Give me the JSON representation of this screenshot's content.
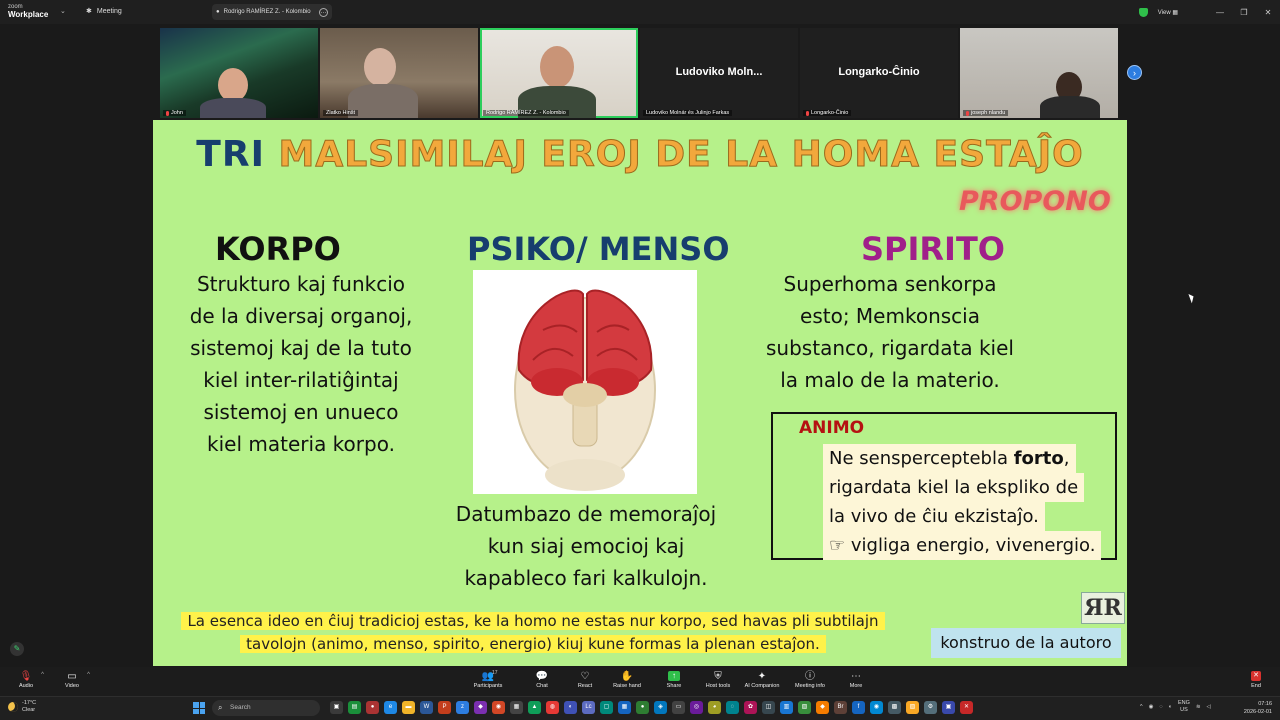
{
  "titlebar": {
    "app_line1": "zoom",
    "app_line2": "Workplace",
    "meeting_label": "Meeting",
    "tab_label": "Rodrigo RAMÍREZ Z. - Kolombio",
    "view_label": "View"
  },
  "gallery": {
    "tiles": [
      {
        "name": "John"
      },
      {
        "name": "Zlatko Hinšt"
      },
      {
        "name": "Rodrigo RAMÍREZ Z. - Kolombio",
        "active": true
      },
      {
        "display": "Ludoviko  Moln...",
        "name": "Ludoviko Molnár és Julinjo Farkas"
      },
      {
        "display": "Longarko-Ĉinio",
        "name": "Longarko-Ĉinio"
      },
      {
        "name": "joseph nlandu"
      }
    ],
    "next_icon": "chevron-right-icon"
  },
  "slide": {
    "title_tri": "TRI",
    "title_rest": "MALSIMILAJ EROJ DE LA HOMA ESTAĴO",
    "propono": "PROPONO",
    "korpo_heading": "KORPO",
    "korpo_lines": [
      "Strukturo kaj funkcio",
      "de la diversaj organoj,",
      "sistemoj kaj de la tuto",
      "kiel inter-rilatiĝintaj",
      "sistemoj en unueco",
      "kiel materia korpo."
    ],
    "psiko_heading": "PSIKO/ MENSO",
    "psiko_lines": [
      "Datumbazo de memoraĵoj",
      "kun siaj emocioj kaj",
      "kapableco fari kalkulojn."
    ],
    "spirito_heading": "SPIRITO",
    "spirito_lines": [
      "Superhoma senkorpa",
      "esto; Memkonscia",
      "substanco, rigardata kiel",
      "la malo de la materio."
    ],
    "animo_heading": "ANIMO",
    "animo_line1_pre": "Ne sensperceptebla ",
    "animo_line1_bold": "forto",
    "animo_line1_post": ",",
    "animo_line2": "rigardata kiel la eksplikо de",
    "animo_line3": "la vivo de ĉiu ekzistaĵo.",
    "animo_line4": "☞ vigliga energio, vivenergio.",
    "bottom_line1": "La esenca ideo en ĉiuj tradicioj estas, ke la homo ne estas nur korpo, sed havas pli subtilajn",
    "bottom_line2": "tavolojn (animo, menso, spirito, energio) kiuj kune formas la plenan estaĵon.",
    "logo_text": "ЯR",
    "autor_label": "konstruo de la autoro"
  },
  "toolbar": {
    "audio": "Audio",
    "video": "Video",
    "participants": "Participants",
    "participants_count": "17",
    "chat": "Chat",
    "react": "React",
    "raise_hand": "Raise hand",
    "share": "Share",
    "host_tools": "Host tools",
    "ai_companion": "AI Companion",
    "meeting_info": "Meeting info",
    "more": "More",
    "end": "End"
  },
  "taskbar": {
    "temp": "-17°C",
    "weather": "Clear",
    "search_placeholder": "Search",
    "lang1": "ENG",
    "lang2": "US",
    "time": "07:16",
    "date": "2026-02-01"
  },
  "colors": {
    "slide_bg": "#b6f18a",
    "title_blue": "#173e6e",
    "title_orange": "#f2a83c",
    "spirito_purple": "#a0208a",
    "active_green": "#2dce5c"
  }
}
